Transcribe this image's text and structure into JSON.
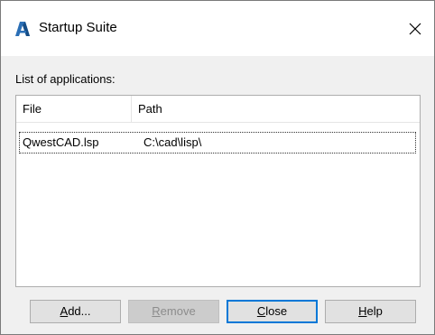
{
  "window": {
    "title": "Startup Suite",
    "close_glyph": "×",
    "icon": "autocad-a-icon",
    "accent": "#0078d7"
  },
  "list": {
    "label": "List of applications:",
    "columns": [
      "File",
      "Path"
    ],
    "rows": [
      {
        "file": "QwestCAD.lsp",
        "path": "C:\\cad\\lisp\\"
      }
    ]
  },
  "buttons": {
    "add": {
      "mnemonic": "A",
      "rest": "dd..."
    },
    "remove": {
      "mnemonic": "R",
      "rest": "emove"
    },
    "close": {
      "mnemonic": "C",
      "rest": "lose"
    },
    "help": {
      "mnemonic": "H",
      "rest": "elp"
    }
  }
}
